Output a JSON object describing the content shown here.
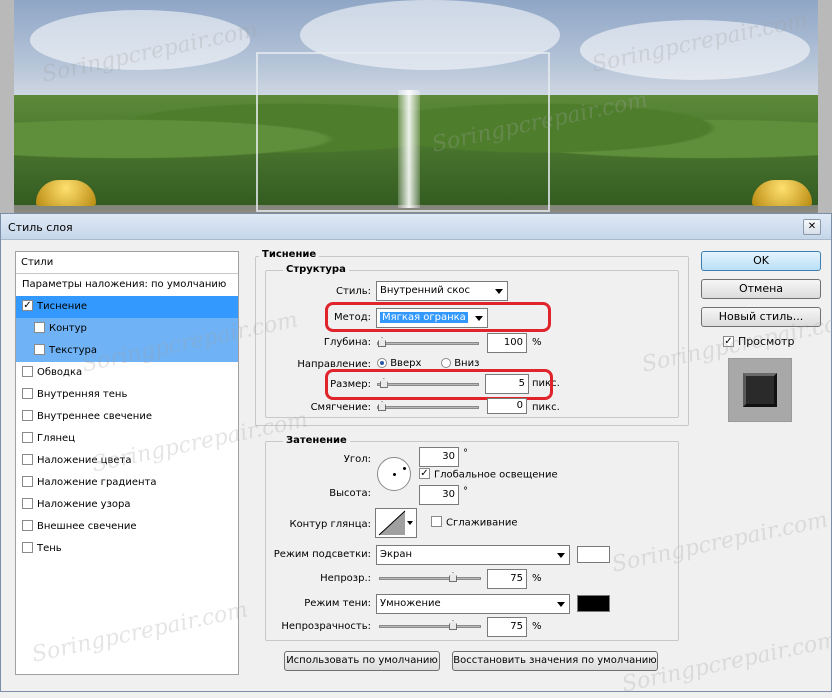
{
  "watermark": "Soringpcrepair.com",
  "dialog": {
    "title": "Стиль слоя",
    "close_glyph": "✕"
  },
  "styles_panel": {
    "header": "Стили",
    "blending_defaults": "Параметры наложения: по умолчанию",
    "items": [
      {
        "label": "Тиснение",
        "checked": true
      },
      {
        "label": "Контур",
        "checked": false
      },
      {
        "label": "Текстура",
        "checked": false
      },
      {
        "label": "Обводка",
        "checked": false
      },
      {
        "label": "Внутренняя тень",
        "checked": false
      },
      {
        "label": "Внутреннее свечение",
        "checked": false
      },
      {
        "label": "Глянец",
        "checked": false
      },
      {
        "label": "Наложение цвета",
        "checked": false
      },
      {
        "label": "Наложение градиента",
        "checked": false
      },
      {
        "label": "Наложение узора",
        "checked": false
      },
      {
        "label": "Внешнее свечение",
        "checked": false
      },
      {
        "label": "Тень",
        "checked": false
      }
    ],
    "check_glyph": "✓"
  },
  "bevel": {
    "section_title": "Тиснение",
    "structure_title": "Структура",
    "style_label": "Стиль:",
    "style_value": "Внутренний скос",
    "method_label": "Метод:",
    "method_value": "Мягкая огранка",
    "depth_label": "Глубина:",
    "depth_value": "100",
    "depth_unit": "%",
    "depth_level": 0.0,
    "direction_label": "Направление:",
    "direction_up": "Вверх",
    "direction_down": "Вниз",
    "size_label": "Размер:",
    "size_value": "5",
    "size_unit": "пикс.",
    "size_level": 0.02,
    "soften_label": "Смягчение:",
    "soften_value": "0",
    "soften_unit": "пикс.",
    "soften_level": 0.0
  },
  "shading": {
    "section_title": "Затенение",
    "angle_label": "Угол:",
    "angle_value": "30",
    "degree_symbol": "°",
    "global_light_label": "Глобальное освещение",
    "global_light_checked": true,
    "altitude_label": "Высота:",
    "altitude_value": "30",
    "gloss_contour_label": "Контур глянца:",
    "antialias_label": "Сглаживание",
    "highlight_mode_label": "Режим подсветки:",
    "highlight_mode_value": "Экран",
    "highlight_color": "#ffffff",
    "highlight_opacity_label": "Непрозр.:",
    "highlight_opacity_value": "75",
    "highlight_opacity_level": 0.75,
    "shadow_mode_label": "Режим тени:",
    "shadow_mode_value": "Умножение",
    "shadow_color": "#000000",
    "shadow_opacity_label": "Непрозрачность:",
    "shadow_opacity_value": "75",
    "shadow_opacity_level": 0.75,
    "percent": "%"
  },
  "footer": {
    "make_default": "Использовать по умолчанию",
    "reset_default": "Восстановить значения по умолчанию"
  },
  "right_panel": {
    "ok": "OK",
    "cancel": "Отмена",
    "new_style": "Новый стиль...",
    "preview_label": "Просмотр",
    "preview_checked": true
  },
  "highlight_color_annotation": "#e0242c"
}
